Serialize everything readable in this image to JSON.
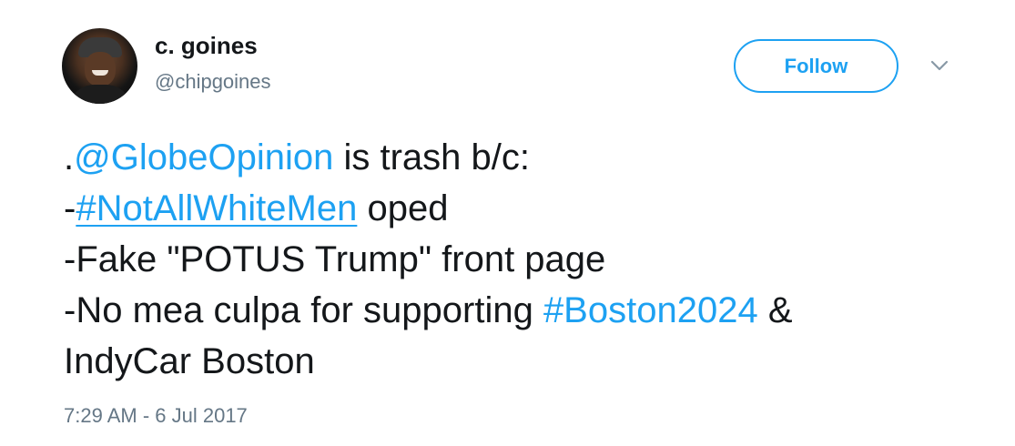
{
  "author": {
    "name": "c. goines",
    "handle": "@chipgoines",
    "avatar_icon": "profile-photo"
  },
  "follow_label": "Follow",
  "caret_icon": "chevron-down-icon",
  "tweet": {
    "line1": {
      "prefix": ".",
      "mention": "@GlobeOpinion",
      "suffix": " is trash b/c:"
    },
    "line2": {
      "prefix": "-",
      "hashtag": "#NotAllWhiteMen",
      "suffix": " oped"
    },
    "line3": {
      "text": "-Fake \"POTUS Trump\" front page"
    },
    "line4": {
      "prefix": "-No mea culpa for supporting ",
      "hashtag": "#Boston2024",
      "suffix": " &"
    },
    "line5": {
      "text": "IndyCar Boston"
    }
  },
  "timestamp": "7:29 AM - 6 Jul 2017",
  "colors": {
    "accent": "#1da1f2",
    "text": "#14171a",
    "muted": "#657786"
  }
}
